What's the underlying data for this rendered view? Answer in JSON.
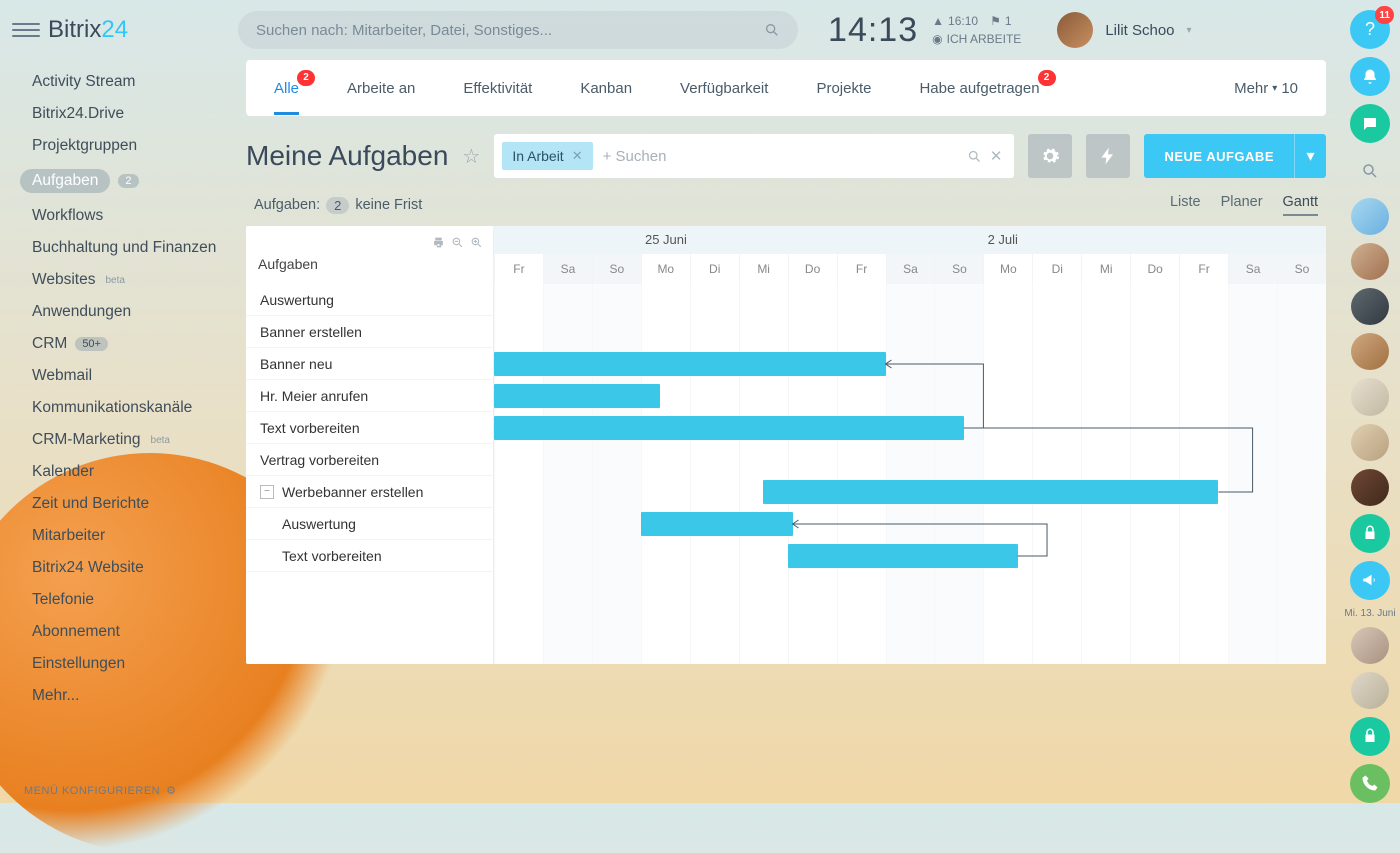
{
  "brand": {
    "name": "Bitrix",
    "suffix": "24"
  },
  "search": {
    "placeholder": "Suchen nach: Mitarbeiter, Datei, Sonstiges..."
  },
  "clock": {
    "time": "14:13",
    "bell_time": "16:10",
    "flag_count": "1",
    "status": "ICH ARBEITE"
  },
  "user": {
    "name": "Lilit Schoo"
  },
  "sidebar": {
    "items": [
      {
        "label": "Activity Stream"
      },
      {
        "label": "Bitrix24.Drive"
      },
      {
        "label": "Projektgruppen"
      },
      {
        "label": "Aufgaben",
        "badge": "2",
        "active": true
      },
      {
        "label": "Workflows"
      },
      {
        "label": "Buchhaltung und Finanzen"
      },
      {
        "label": "Websites",
        "sup": "beta"
      },
      {
        "label": "Anwendungen"
      },
      {
        "label": "CRM",
        "badge": "50+"
      },
      {
        "label": "Webmail"
      },
      {
        "label": "Kommunikationskanäle"
      },
      {
        "label": "CRM-Marketing",
        "sup": "beta"
      },
      {
        "label": "Kalender"
      },
      {
        "label": "Zeit und Berichte"
      },
      {
        "label": "Mitarbeiter"
      },
      {
        "label": "Bitrix24 Website"
      },
      {
        "label": "Telefonie"
      },
      {
        "label": "Abonnement"
      },
      {
        "label": "Einstellungen"
      },
      {
        "label": "Mehr..."
      }
    ],
    "configure": "MENÜ KONFIGURIEREN"
  },
  "tabs": {
    "items": [
      {
        "label": "Alle",
        "badge": "2",
        "active": true
      },
      {
        "label": "Arbeite an"
      },
      {
        "label": "Effektivität"
      },
      {
        "label": "Kanban"
      },
      {
        "label": "Verfügbarkeit"
      },
      {
        "label": "Projekte"
      },
      {
        "label": "Habe aufgetragen",
        "badge": "2"
      }
    ],
    "more": {
      "label": "Mehr",
      "badge": "10"
    }
  },
  "page": {
    "title": "Meine Aufgaben"
  },
  "filter": {
    "chip": "In Arbeit",
    "placeholder": "+ Suchen"
  },
  "buttons": {
    "new_task": "NEUE AUFGABE"
  },
  "sub": {
    "label": "Aufgaben:",
    "count": "2",
    "suffix": "keine Frist"
  },
  "views": {
    "list": "Liste",
    "planer": "Planer",
    "gantt": "Gantt"
  },
  "gantt": {
    "left_header": "Aufgaben",
    "month_labels": [
      "25 Juni",
      "2 Juli"
    ],
    "days": [
      "Fr",
      "Sa",
      "So",
      "Mo",
      "Di",
      "Mi",
      "Do",
      "Fr",
      "Sa",
      "So",
      "Mo",
      "Di",
      "Mi",
      "Do",
      "Fr",
      "Sa",
      "So"
    ],
    "weekend_idx": [
      1,
      2,
      8,
      9,
      15,
      16
    ],
    "month_label_idx": [
      3,
      10
    ],
    "tasks": [
      {
        "name": "Auswertung"
      },
      {
        "name": "Banner erstellen"
      },
      {
        "name": "Banner neu",
        "start": 0,
        "span": 8
      },
      {
        "name": "Hr. Meier anrufen",
        "start": 0,
        "span": 3.4
      },
      {
        "name": "Text vorbereiten",
        "start": 0,
        "span": 9.6
      },
      {
        "name": "Vertrag vorbereiten"
      },
      {
        "name": "Werbebanner erstellen",
        "start": 5.5,
        "span": 9.3,
        "expandable": true
      },
      {
        "name": "Auswertung",
        "start": 3,
        "span": 3.1,
        "sub": true
      },
      {
        "name": "Text vorbereiten",
        "start": 6,
        "span": 4.7,
        "sub": true
      }
    ]
  },
  "rail": {
    "help_badge": "11",
    "date": "Mi. 13. Juni"
  }
}
